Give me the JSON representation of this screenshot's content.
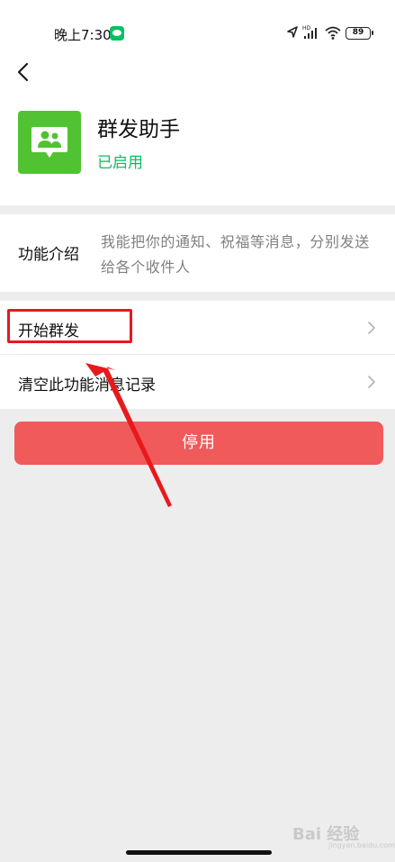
{
  "status_bar": {
    "time": "晚上7:30",
    "battery": "89",
    "icons": [
      "wechat-icon",
      "location-arrow-icon",
      "signal-icon",
      "wifi-icon",
      "battery-icon"
    ]
  },
  "nav": {
    "back_icon": "chevron-left-icon"
  },
  "app": {
    "name": "群发助手",
    "status": "已启用",
    "icon": "group-chat-icon"
  },
  "intro": {
    "label": "功能介绍",
    "text": "我能把你的通知、祝福等消息，分别发送给各个收件人"
  },
  "actions": {
    "start_label": "开始群发",
    "clear_label": "清空此功能消息记录",
    "disable_label": "停用"
  },
  "colors": {
    "accent_green": "#07c160",
    "app_icon_green": "#51c332",
    "disable_red": "#f05a5a",
    "annotation_red": "#e8191c"
  },
  "watermark": {
    "text": "Bai 经验",
    "sub": "jingyan.baidu.com"
  }
}
